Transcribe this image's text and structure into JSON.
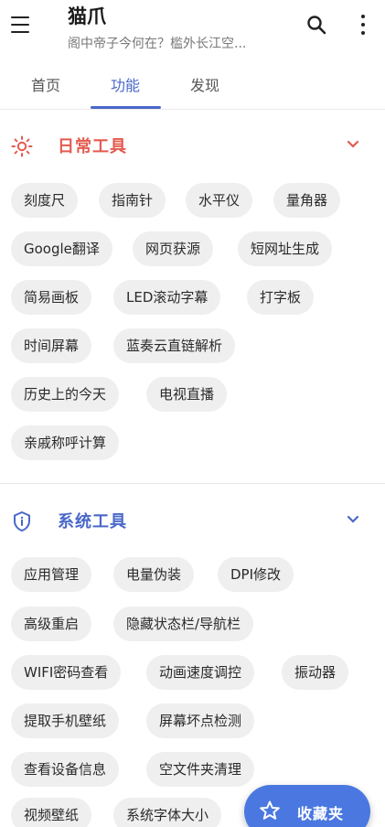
{
  "appbar": {
    "title": "猫爪",
    "subtitle": "阁中帝子今何在？槛外长江空..."
  },
  "tabs": [
    {
      "label": "首页",
      "active": false
    },
    {
      "label": "功能",
      "active": true
    },
    {
      "label": "发现",
      "active": false
    }
  ],
  "sections": [
    {
      "title": "日常工具",
      "icon": "sun-icon",
      "color": "#e45a4f",
      "chips": [
        "刻度尺",
        "指南针",
        "水平仪",
        "量角器",
        "Google翻译",
        "网页获源",
        "短网址生成",
        "简易画板",
        "LED滚动字幕",
        "打字板",
        "时间屏幕",
        "蓝奏云直链解析",
        "历史上的今天",
        "电视直播",
        "亲戚称呼计算"
      ]
    },
    {
      "title": "系统工具",
      "icon": "shield-info-icon",
      "color": "#4a68c9",
      "chips": [
        "应用管理",
        "电量伪装",
        "DPI修改",
        "高级重启",
        "隐藏状态栏/导航栏",
        "WIFI密码查看",
        "动画速度调控",
        "振动器",
        "提取手机壁纸",
        "屏幕坏点检测",
        "查看设备信息",
        "空文件夹清理",
        "视频壁纸",
        "系统字体大小"
      ]
    }
  ],
  "fab": {
    "label": "收藏夹",
    "icon": "star-icon"
  },
  "colors": {
    "accent": "#4a68c9",
    "fab": "#4a78e0",
    "chip_bg": "#efefef"
  }
}
